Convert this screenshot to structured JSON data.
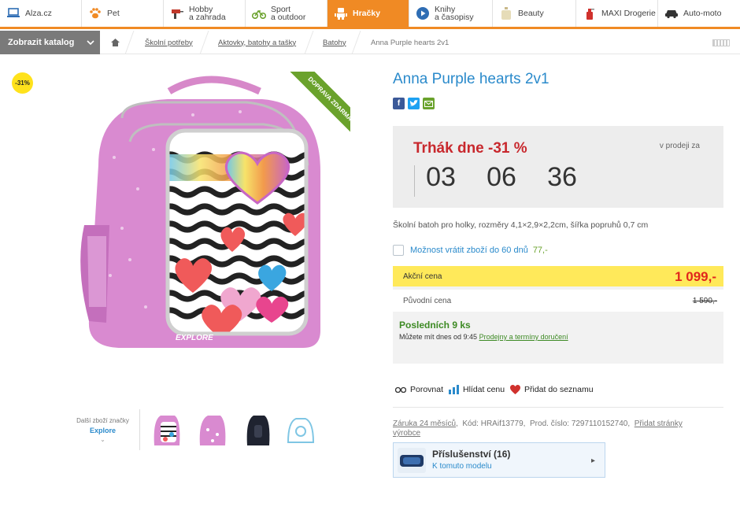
{
  "topnav": [
    {
      "label": "Alza.cz",
      "icon": "laptop-icon"
    },
    {
      "label": "Pet",
      "icon": "paw-icon"
    },
    {
      "label": "Hobby\na zahrada",
      "icon": "drill-icon"
    },
    {
      "label": "Sport\na outdoor",
      "icon": "bicycle-icon"
    },
    {
      "label": "Hračky",
      "icon": "robot-icon",
      "active": true
    },
    {
      "label": "Knihy\na časopisy",
      "icon": "play-icon"
    },
    {
      "label": "Beauty",
      "icon": "perfume-icon"
    },
    {
      "label": "MAXI Drogerie",
      "icon": "spray-icon"
    },
    {
      "label": "Auto-moto",
      "icon": "car-icon"
    }
  ],
  "catalog": {
    "label": "Zobrazit katalog"
  },
  "breadcrumb": {
    "items": [
      "Školní potřeby",
      "Aktovky, batohy a tašky",
      "Batohy"
    ],
    "current": "Anna Purple hearts 2v1"
  },
  "gallery": {
    "discount_badge": "-31%",
    "ribbon": "DOPRAVA ZDARMA",
    "brand_label": "Další zboží značky",
    "brand_name": "Explore",
    "logo_text": "EXPLORE"
  },
  "product": {
    "title": "Anna Purple hearts 2v1",
    "deal": {
      "title": "Trhák dne -31 %",
      "subtitle": "v prodeji za",
      "countdown": [
        "03",
        "06",
        "36"
      ]
    },
    "description": "Školní batoh pro holky, rozměry 4,1×2,9×2,2cm, šířka popruhů 0,7 cm",
    "return_option": {
      "label": "Možnost vrátit zboží do 60 dnů",
      "price": "77,-"
    },
    "prices": {
      "action_label": "Akční cena",
      "action_value": "1 099,-",
      "original_label": "Původní cena",
      "original_value": "1 590,-"
    },
    "stock": "Posledních 9 ks",
    "delivery_text": "Můžete mít dnes od 9:45",
    "delivery_link": "Prodejny a termíny doručení",
    "actions": {
      "compare": "Porovnat",
      "watch": "Hlídat cenu",
      "wishlist": "Přidat do seznamu"
    },
    "meta": {
      "warranty": "Záruka 24 měsíců",
      "code": "Kód: HRAif13779,",
      "prod": "Prod. číslo: 7297110152740,",
      "maker_link": "Přidat stránky výrobce"
    },
    "accessories": {
      "title": "Příslušenství (16)",
      "subtitle": "K tomuto modelu"
    }
  },
  "colors": {
    "accent": "#f08a24",
    "link": "#2a8acb",
    "price": "#e1261c",
    "deal": "#c8282d",
    "stock": "#3d8a24"
  }
}
